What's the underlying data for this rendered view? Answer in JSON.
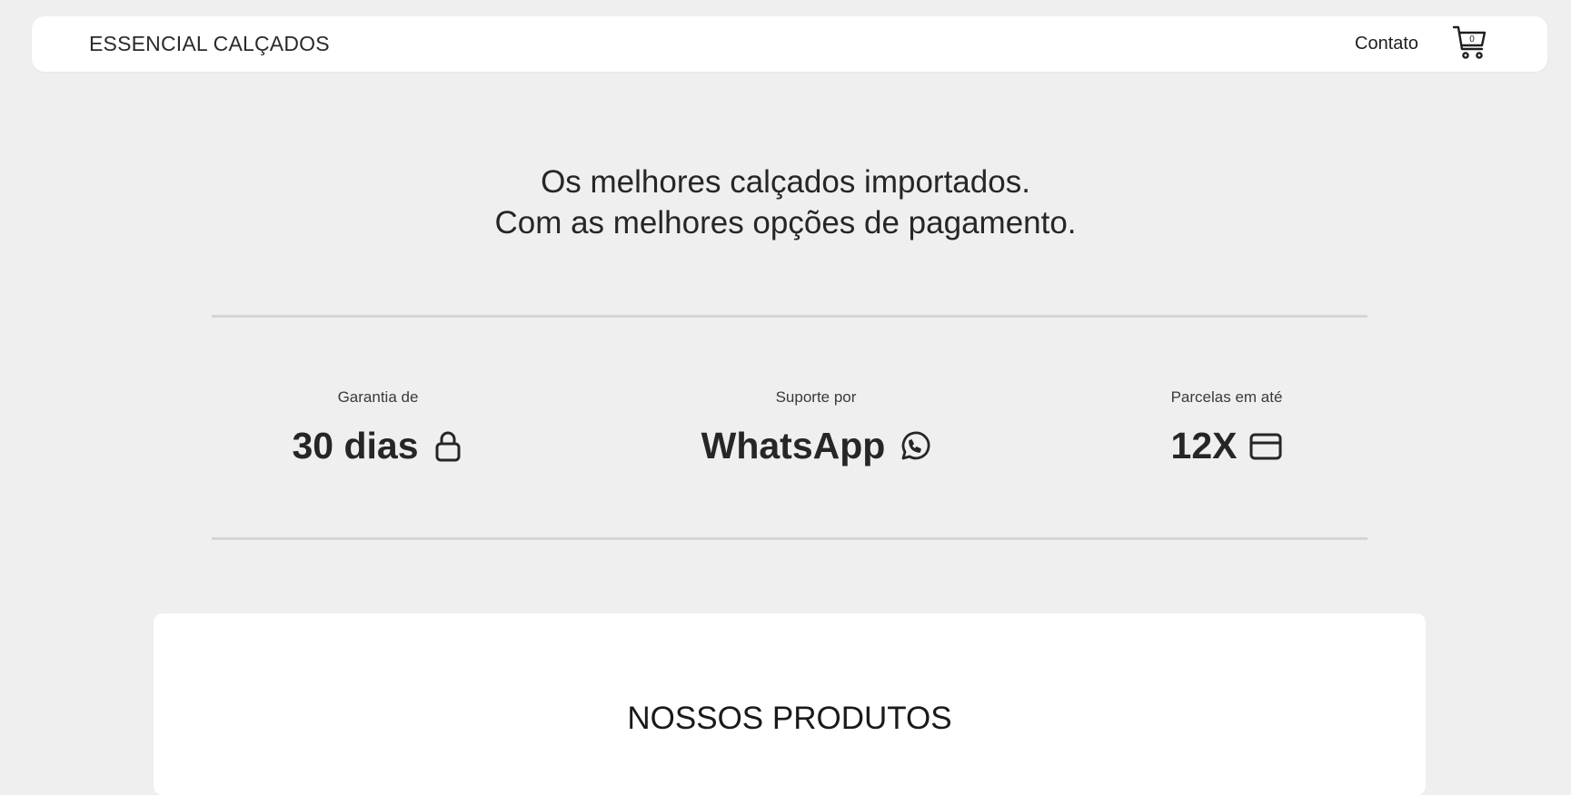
{
  "header": {
    "brand": "ESSENCIAL CALÇADOS",
    "nav_contact": "Contato",
    "cart_count": "0",
    "cart_icon": "shopping-cart-icon"
  },
  "hero": {
    "line1": "Os melhores calçados importados.",
    "line2": "Com as melhores opções de pagamento."
  },
  "features": [
    {
      "label": "Garantia de",
      "value": "30 dias",
      "icon": "lock-icon"
    },
    {
      "label": "Suporte por",
      "value": "WhatsApp",
      "icon": "whatsapp-icon"
    },
    {
      "label": "Parcelas em até",
      "value": "12X",
      "icon": "credit-card-icon"
    }
  ],
  "products": {
    "title": "NOSSOS PRODUTOS"
  },
  "colors": {
    "background": "#efefef",
    "card": "#ffffff",
    "text": "#262626",
    "divider": "#d5d5d5"
  }
}
